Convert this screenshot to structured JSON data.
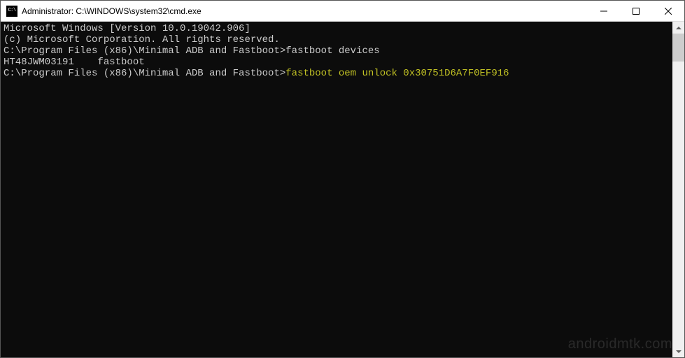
{
  "titlebar": {
    "icon_label": "C:\\",
    "title": "Administrator: C:\\WINDOWS\\system32\\cmd.exe"
  },
  "terminal": {
    "line1": "Microsoft Windows [Version 10.0.19042.906]",
    "line2": "(c) Microsoft Corporation. All rights reserved.",
    "blank1": "",
    "prompt1": "C:\\Program Files (x86)\\Minimal ADB and Fastboot>",
    "cmd1": "fastboot devices",
    "output1": "HT48JWM03191    fastboot",
    "blank2": "",
    "prompt2": "C:\\Program Files (x86)\\Minimal ADB and Fastboot>",
    "cmd2": "fastboot oem unlock 0x30751D6A7F0EF916"
  },
  "watermark": "androidmtk.com"
}
